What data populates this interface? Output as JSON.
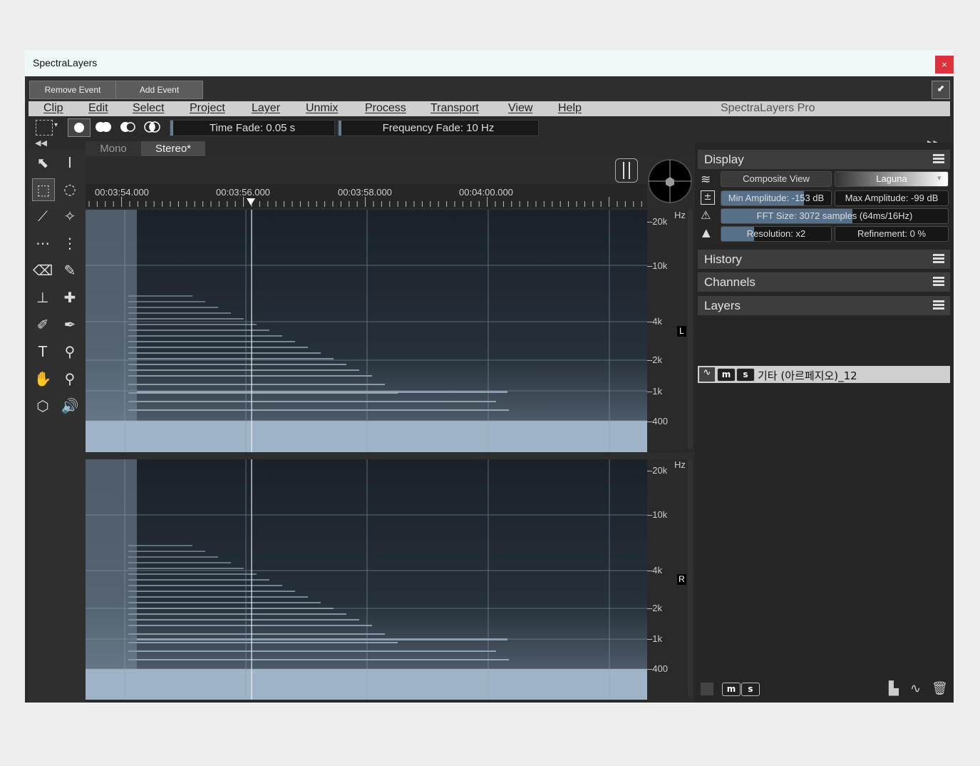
{
  "window": {
    "title": "SpectraLayers",
    "close_glyph": "×",
    "restore_glyph": "⬋"
  },
  "event_bar": {
    "remove_label": "Remove Event",
    "add_label": "Add Event"
  },
  "menu": {
    "items": [
      "Clip",
      "Edit",
      "Select",
      "Project",
      "Layer",
      "Unmix",
      "Process",
      "Transport",
      "View",
      "Help"
    ],
    "brand": "SpectraLayers Pro"
  },
  "tool_options": {
    "time_fade": "Time Fade: 0.05  s",
    "frequency_fade": "Frequency Fade: 10  Hz"
  },
  "tabs": {
    "mono": "Mono",
    "stereo": "Stereo*"
  },
  "timeline": {
    "labels": [
      "00:03:54.000",
      "00:03:56.000",
      "00:03:58.000",
      "00:04:00.000"
    ]
  },
  "freq_scale": {
    "unit": "Hz",
    "labels": [
      "20k",
      "10k",
      "4k",
      "2k",
      "1k",
      "400"
    ]
  },
  "channels": {
    "left": "L",
    "right": "R"
  },
  "display": {
    "title": "Display",
    "composite_view": "Composite View",
    "colormap": "Laguna",
    "min_amplitude": "Min Amplitude: -153 dB",
    "max_amplitude": "Max Amplitude: -99 dB",
    "fft_size": "FFT Size: 3072 samples (64ms/16Hz)",
    "resolution": "Resolution: x2",
    "refinement": "Refinement: 0  %",
    "min_amp_level": 0.75,
    "fft_level": 0.58,
    "resolution_level": 0.3
  },
  "history": {
    "title": "History"
  },
  "channels_panel": {
    "title": "Channels"
  },
  "layers": {
    "title": "Layers",
    "m_label": "m",
    "s_label": "s",
    "items": [
      {
        "name": "기타 (아르페지오)_12"
      }
    ]
  },
  "colors": {
    "accent": "#56708a",
    "spectrogram_fill": "#9fb3c6",
    "close": "#e0303a"
  }
}
